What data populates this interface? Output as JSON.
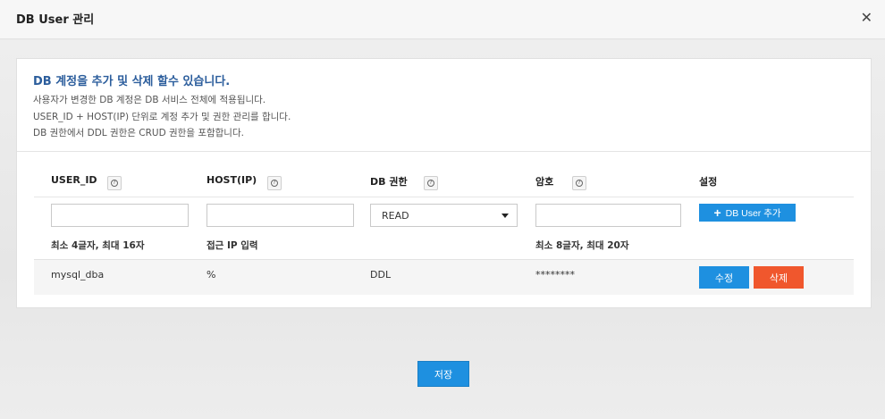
{
  "dialog": {
    "title": "DB User 관리",
    "close_icon": "close-icon"
  },
  "info": {
    "title": "DB 계정을 추가 및 삭제 할수 있습니다.",
    "lines": [
      "사용자가 변경한 DB 계정은 DB 서비스 전체에 적용됩니다.",
      "USER_ID + HOST(IP) 단위로 계정 추가 및 권한 관리를 합니다.",
      "DB 권한에서 DDL 권한은 CRUD 권한을 포함합니다."
    ]
  },
  "table": {
    "headers": [
      "USER_ID",
      "HOST(IP)",
      "DB 권한",
      "암호",
      "설정"
    ],
    "new_row": {
      "user_id": "",
      "host": "",
      "privilege": "READ",
      "password": "",
      "add_button": "DB User 추가"
    },
    "hints": {
      "user_id": "최소 4글자, 최대 16자",
      "host": "접근 IP 입력",
      "password": "최소 8글자, 최대 20자"
    },
    "rows": [
      {
        "user_id": "mysql_dba",
        "host": "%",
        "privilege": "DDL",
        "password": "********",
        "edit_label": "수정",
        "delete_label": "삭제"
      }
    ]
  },
  "footer": {
    "save_label": "저장"
  },
  "colors": {
    "primary": "#1e90e0",
    "danger": "#f0572d",
    "info_title": "#2b5d9c"
  }
}
